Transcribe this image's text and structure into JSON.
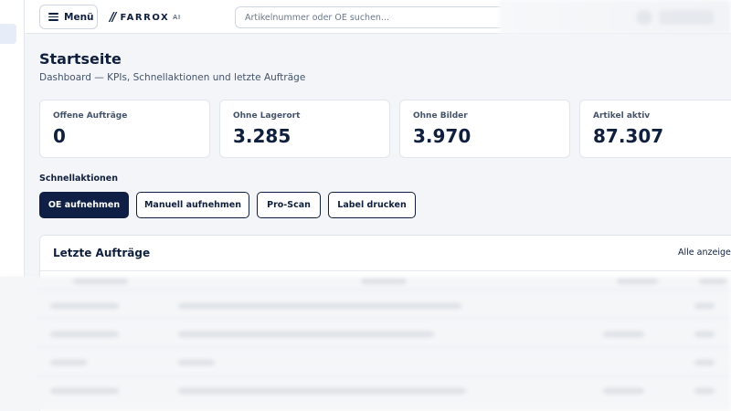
{
  "header": {
    "menu_label": "Menü",
    "logo_mark": "//",
    "logo_text": "FARROX",
    "logo_sub": "AI",
    "search_placeholder": "Artikelnummer oder OE suchen..."
  },
  "page": {
    "title": "Startseite",
    "subtitle": "Dashboard — KPIs, Schnellaktionen und letzte Aufträge"
  },
  "kpis": [
    {
      "label": "Offene Aufträge",
      "value": "0"
    },
    {
      "label": "Ohne Lagerort",
      "value": "3.285"
    },
    {
      "label": "Ohne Bilder",
      "value": "3.970"
    },
    {
      "label": "Artikel aktiv",
      "value": "87.307"
    }
  ],
  "quick_actions": {
    "heading": "Schnellaktionen",
    "buttons": [
      "OE aufnehmen",
      "Manuell aufnehmen",
      "Pro-Scan",
      "Label drucken"
    ]
  },
  "recent_orders": {
    "title": "Letzte Aufträge",
    "show_all": "Alle anzeigen"
  },
  "colors": {
    "brand_navy": "#0f1f45",
    "background": "#f3f5f8",
    "card": "#ffffff"
  },
  "icons": {
    "menu": "hamburger-icon"
  }
}
